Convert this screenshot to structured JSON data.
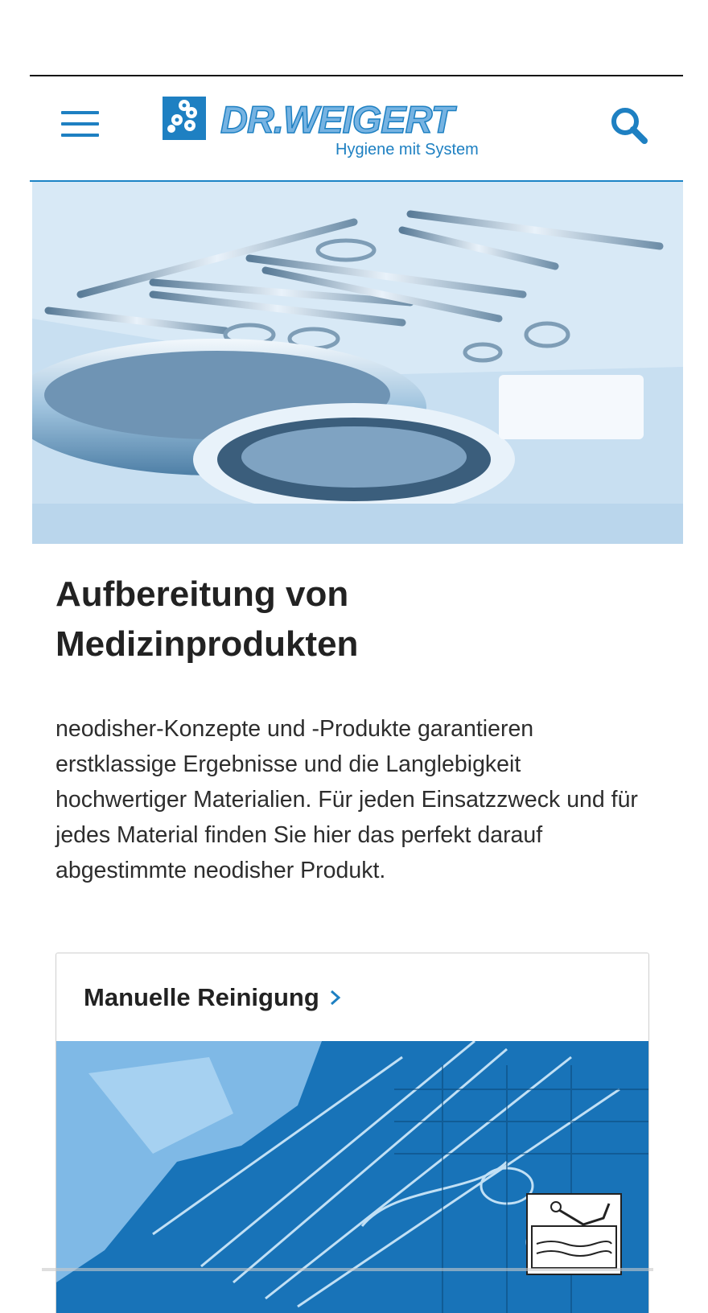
{
  "header": {
    "menu_icon": "hamburger-menu-icon",
    "logo": {
      "wordmark": "DR.WEIGERT",
      "tagline": "Hygiene mit System"
    },
    "search_icon": "search-icon",
    "brand_color": "#1e80c2"
  },
  "hero": {
    "image_subject": "surgical instruments on a tray"
  },
  "main": {
    "title_line1": "Aufbereitung von",
    "title_line2": "Medizinprodukten",
    "intro": "neodisher-Konzepte und -Produkte garantieren erstklassige Ergebnisse und die Langlebigkeit hochwertiger Materialien. Für jeden Einsatzzweck und für jedes Material finden Sie hier das perfekt darauf abgestimmte neodisher Produkt."
  },
  "cards": [
    {
      "title": "Manuelle Reinigung",
      "chevron_icon": "chevron-right-icon",
      "badge_icon": "manual-cleaning-sink-icon"
    }
  ]
}
